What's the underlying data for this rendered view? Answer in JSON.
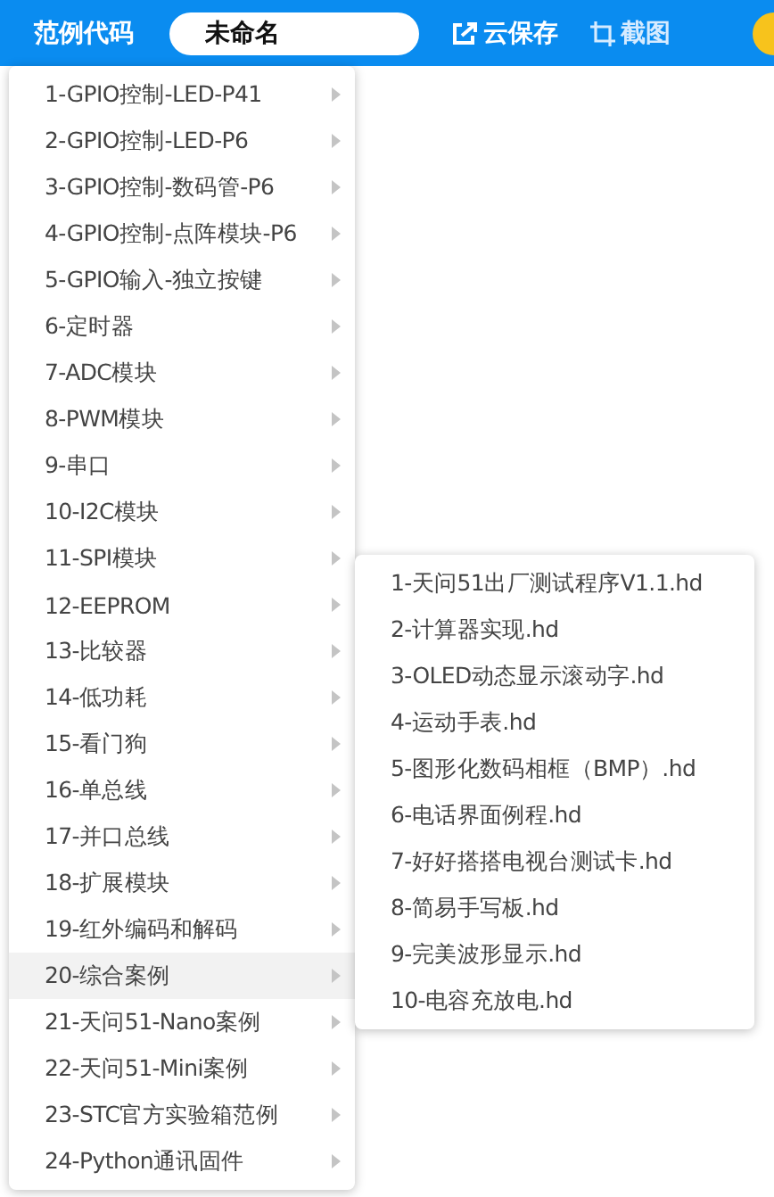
{
  "toolbar": {
    "examples_label": "范例代码",
    "file_name": "未命名",
    "cloud_save": "云保存",
    "screenshot": "截图"
  },
  "menu": {
    "items": [
      {
        "label": "1-GPIO控制-LED-P41",
        "selected": false
      },
      {
        "label": "2-GPIO控制-LED-P6",
        "selected": false
      },
      {
        "label": "3-GPIO控制-数码管-P6",
        "selected": false
      },
      {
        "label": "4-GPIO控制-点阵模块-P6",
        "selected": false
      },
      {
        "label": "5-GPIO输入-独立按键",
        "selected": false
      },
      {
        "label": "6-定时器",
        "selected": false
      },
      {
        "label": "7-ADC模块",
        "selected": false
      },
      {
        "label": "8-PWM模块",
        "selected": false
      },
      {
        "label": "9-串口",
        "selected": false
      },
      {
        "label": "10-I2C模块",
        "selected": false
      },
      {
        "label": "11-SPI模块",
        "selected": false
      },
      {
        "label": "12-EEPROM",
        "selected": false
      },
      {
        "label": "13-比较器",
        "selected": false
      },
      {
        "label": "14-低功耗",
        "selected": false
      },
      {
        "label": "15-看门狗",
        "selected": false
      },
      {
        "label": "16-单总线",
        "selected": false
      },
      {
        "label": "17-并口总线",
        "selected": false
      },
      {
        "label": "18-扩展模块",
        "selected": false
      },
      {
        "label": "19-红外编码和解码",
        "selected": false
      },
      {
        "label": "20-综合案例",
        "selected": true
      },
      {
        "label": "21-天问51-Nano案例",
        "selected": false
      },
      {
        "label": "22-天问51-Mini案例",
        "selected": false
      },
      {
        "label": "23-STC官方实验箱范例",
        "selected": false
      },
      {
        "label": "24-Python通讯固件",
        "selected": false
      }
    ]
  },
  "submenu": {
    "items": [
      "1-天问51出厂测试程序V1.1.hd",
      "2-计算器实现.hd",
      "3-OLED动态显示滚动字.hd",
      "4-运动手表.hd",
      "5-图形化数码相框（BMP）.hd",
      "6-电话界面例程.hd",
      "7-好好搭搭电视台测试卡.hd",
      "8-简易手写板.hd",
      "9-完美波形显示.hd",
      "10-电容充放电.hd"
    ]
  }
}
